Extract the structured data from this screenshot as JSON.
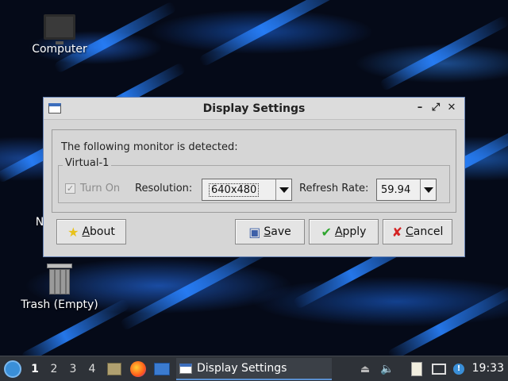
{
  "desktop": {
    "icons": [
      {
        "label": "Computer",
        "icon": "computer-icon"
      },
      {
        "label": "N",
        "icon": "network-icon"
      },
      {
        "label": "Trash (Empty)",
        "icon": "trash-icon"
      }
    ]
  },
  "dialog": {
    "title": "Display Settings",
    "detected_text": "The following monitor is detected:",
    "monitor_name": "Virtual-1",
    "turn_on_label": "Turn On",
    "turn_on_checked": true,
    "resolution_label": "Resolution:",
    "resolution_value": "640x480",
    "refresh_label": "Refresh Rate:",
    "refresh_value": "59.94",
    "buttons": {
      "about": {
        "prefix": "",
        "key": "A",
        "rest": "bout"
      },
      "save": {
        "prefix": "",
        "key": "S",
        "rest": "ave"
      },
      "apply": {
        "prefix": "",
        "key": "A",
        "rest": "pply"
      },
      "cancel": {
        "prefix": "",
        "key": "C",
        "rest": "ancel"
      }
    },
    "window_controls": [
      "minimize",
      "maximize",
      "close"
    ]
  },
  "taskbar": {
    "workspaces": [
      "1",
      "2",
      "3",
      "4"
    ],
    "active_workspace": "1",
    "task_label": "Display Settings",
    "clock": "19:33"
  },
  "colors": {
    "accent": "#3c6ebd",
    "taskbar_bg": "#2e3238"
  }
}
